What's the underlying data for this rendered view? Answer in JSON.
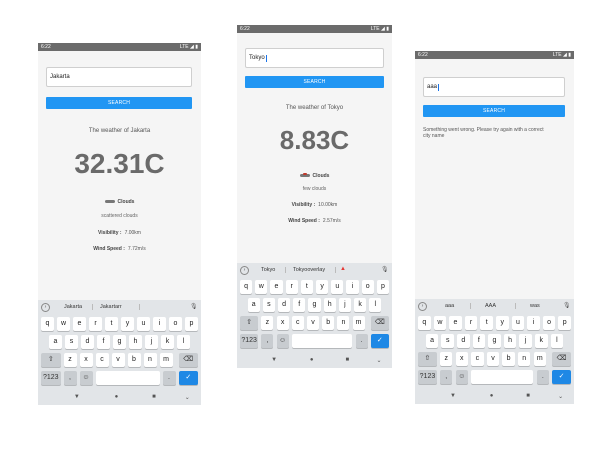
{
  "screens": [
    {
      "status": {
        "time": "6:22",
        "right": "LTE ◢ ▮"
      },
      "input_value": "Jakarta",
      "search_label": "SEARCH",
      "weather_title": "The weather of Jakarta",
      "temperature": "32.31C",
      "condition": "Clouds",
      "description": "scattered clouds",
      "visibility_label": "Visibility :",
      "visibility_value": "7.00km",
      "wind_label": "Wind Speed :",
      "wind_value": "7.72m/s",
      "suggestions": [
        "Jakarta",
        "Jakartarr"
      ]
    },
    {
      "status": {
        "time": "6:22",
        "right": "LTE ◢ ▮"
      },
      "input_value": "Tokyo",
      "search_label": "SEARCH",
      "weather_title": "The weather of Tokyo",
      "temperature": "8.83C",
      "condition": "Clouds",
      "description": "few clouds",
      "visibility_label": "Visibility :",
      "visibility_value": "10.00km",
      "wind_label": "Wind Speed :",
      "wind_value": "2.57m/s",
      "suggestions": [
        "Tokyo",
        "Tokyooverlay"
      ]
    },
    {
      "status": {
        "time": "6:22",
        "right": "LTE ◢ ▮"
      },
      "input_value": "aaa",
      "search_label": "SEARCH",
      "error_line1": "Something went wrong. Please try again with a correct",
      "error_line2": "city name",
      "suggestions": [
        "aaa",
        "AAA",
        "was"
      ]
    }
  ],
  "keyboard": {
    "row1": [
      "q",
      "w",
      "e",
      "r",
      "t",
      "y",
      "u",
      "i",
      "o",
      "p"
    ],
    "row1_hints": [
      "1",
      "2",
      "3",
      "4",
      "5",
      "6",
      "7",
      "8",
      "9",
      "0"
    ],
    "row2": [
      "a",
      "s",
      "d",
      "f",
      "g",
      "h",
      "j",
      "k",
      "l"
    ],
    "row3": [
      "z",
      "x",
      "c",
      "v",
      "b",
      "n",
      "m"
    ],
    "shift": "⇧",
    "backspace": "⌫",
    "symbols": "?123",
    "comma": ",",
    "emoji": "☺",
    "period": ".",
    "enter": "✓",
    "chevron": "›",
    "mic": "🎙",
    "nav_back": "▼",
    "nav_home": "●",
    "nav_recent": "■",
    "nav_hide": "⌄"
  },
  "colors": {
    "accent": "#2196f3",
    "enter": "#1e88e5",
    "statusbar": "#6b6b6b"
  }
}
